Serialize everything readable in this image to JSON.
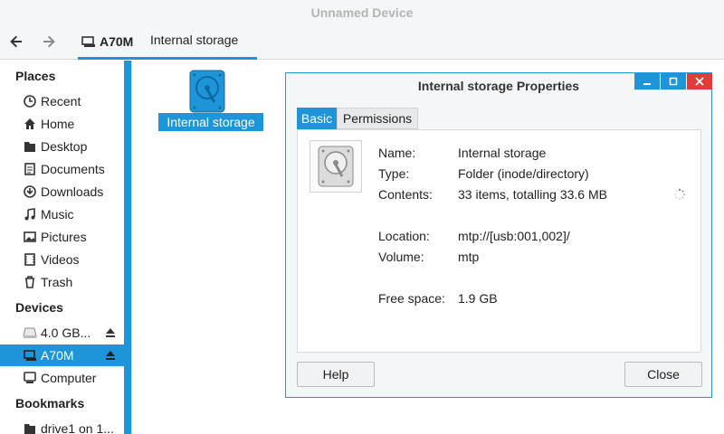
{
  "window": {
    "title": "Unnamed Device"
  },
  "toolbar": {
    "path": [
      {
        "label": "A70M"
      },
      {
        "label": "Internal storage"
      }
    ]
  },
  "sidebar": {
    "places_header": "Places",
    "places": [
      {
        "label": "Recent",
        "icon": "clock-icon"
      },
      {
        "label": "Home",
        "icon": "home-icon"
      },
      {
        "label": "Desktop",
        "icon": "folder-icon"
      },
      {
        "label": "Documents",
        "icon": "documents-icon"
      },
      {
        "label": "Downloads",
        "icon": "download-icon"
      },
      {
        "label": "Music",
        "icon": "music-icon"
      },
      {
        "label": "Pictures",
        "icon": "pictures-icon"
      },
      {
        "label": "Videos",
        "icon": "videos-icon"
      },
      {
        "label": "Trash",
        "icon": "trash-icon"
      }
    ],
    "devices_header": "Devices",
    "devices": [
      {
        "label": "4.0 GB...",
        "icon": "drive-icon",
        "ejectable": true
      },
      {
        "label": "A70M",
        "icon": "phone-icon",
        "ejectable": true,
        "selected": true
      },
      {
        "label": "Computer",
        "icon": "computer-icon"
      }
    ],
    "bookmarks_header": "Bookmarks",
    "bookmarks": [
      {
        "label": "drive1 on 1...",
        "icon": "network-folder-icon"
      }
    ]
  },
  "main": {
    "items": [
      {
        "label": "Internal storage",
        "icon": "drive-icon"
      }
    ]
  },
  "dialog": {
    "title": "Internal storage Properties",
    "tabs": [
      {
        "label": "Basic",
        "active": true
      },
      {
        "label": "Permissions"
      }
    ],
    "props": {
      "name_label": "Name:",
      "name_value": "Internal storage",
      "type_label": "Type:",
      "type_value": "Folder (inode/directory)",
      "contents_label": "Contents:",
      "contents_value": "33 items, totalling 33.6 MB",
      "location_label": "Location:",
      "location_value": "mtp://[usb:001,002]/",
      "volume_label": "Volume:",
      "volume_value": "mtp",
      "free_label": "Free space:",
      "free_value": "1.9 GB"
    },
    "help_label": "Help",
    "close_label": "Close"
  },
  "colors": {
    "accent": "#1e95d9",
    "close": "#e03c3c"
  }
}
